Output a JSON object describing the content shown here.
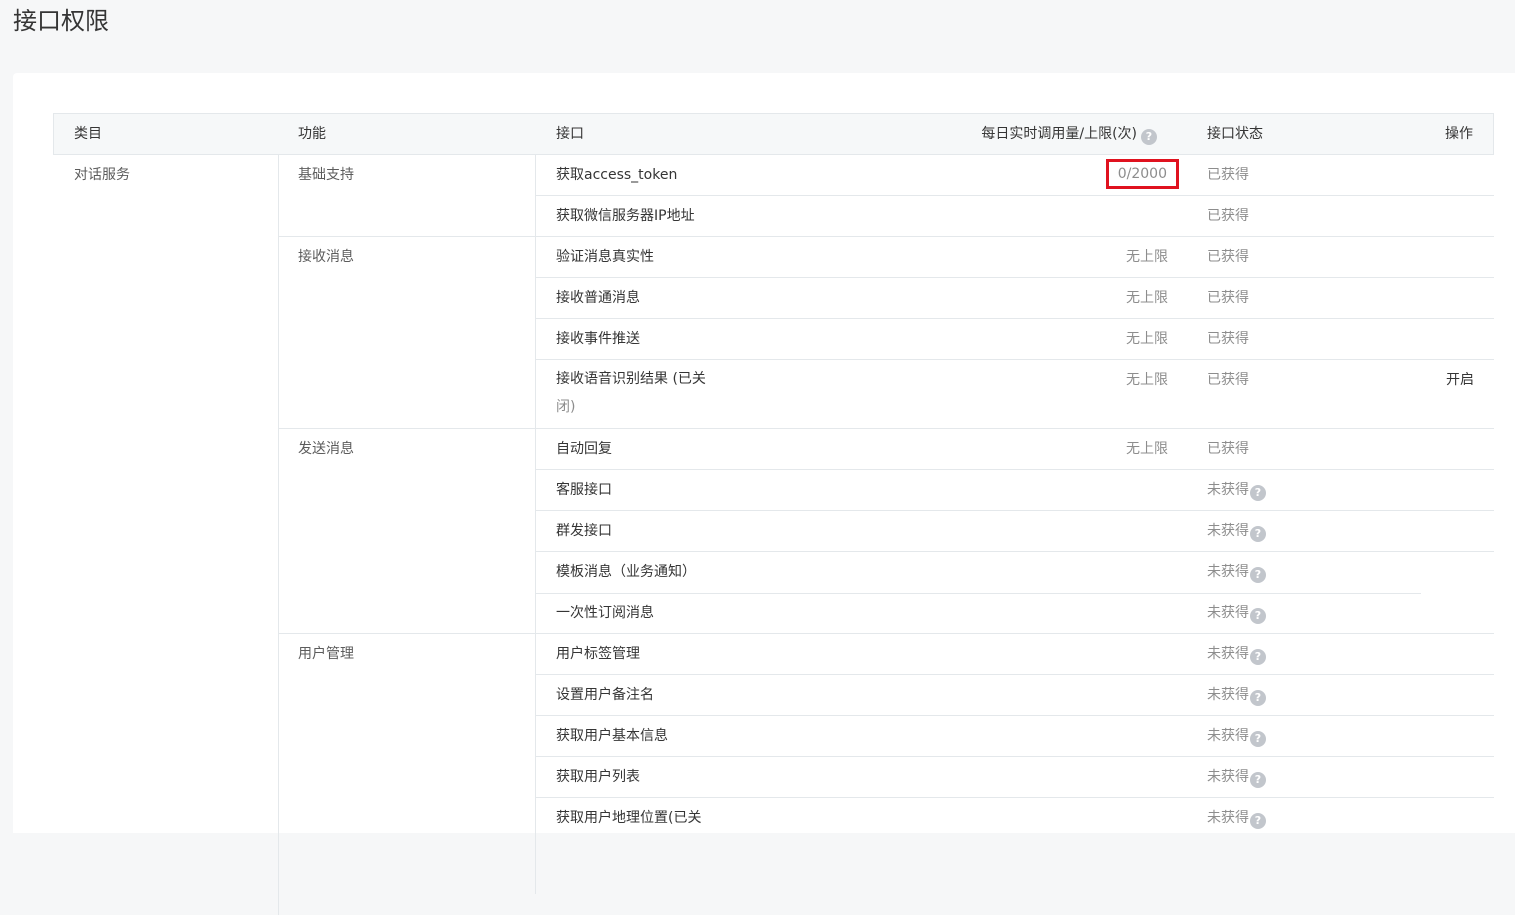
{
  "page": {
    "title": "接口权限"
  },
  "table": {
    "headers": {
      "category": "类目",
      "function": "功能",
      "api": "接口",
      "quota": "每日实时调用量/上限(次)",
      "status": "接口状态",
      "operation": "操作"
    },
    "category": "对话服务",
    "groups": [
      {
        "function": "基础支持"
      },
      {
        "function": "接收消息"
      },
      {
        "function": "发送消息"
      },
      {
        "function": "用户管理"
      }
    ],
    "rows": [
      {
        "api": "获取access_token",
        "quota": "0/2000",
        "status": "已获得"
      },
      {
        "api": "获取微信服务器IP地址",
        "quota": "",
        "status": "已获得"
      },
      {
        "api": "验证消息真实性",
        "quota": "无上限",
        "status": "已获得"
      },
      {
        "api": "接收普通消息",
        "quota": "无上限",
        "status": "已获得"
      },
      {
        "api": "接收事件推送",
        "quota": "无上限",
        "status": "已获得"
      },
      {
        "api": "接收语音识别结果 (已关",
        "api_line2": "闭)",
        "quota": "无上限",
        "status": "已获得",
        "operation": "开启"
      },
      {
        "api": "自动回复",
        "quota": "无上限",
        "status": "已获得"
      },
      {
        "api": "客服接口",
        "status": "未获得"
      },
      {
        "api": "群发接口",
        "status": "未获得"
      },
      {
        "api": "模板消息（业务通知）",
        "status": "未获得"
      },
      {
        "api": "一次性订阅消息",
        "status": "未获得"
      },
      {
        "api": "用户标签管理",
        "status": "未获得"
      },
      {
        "api": "设置用户备注名",
        "status": "未获得"
      },
      {
        "api": "获取用户基本信息",
        "status": "未获得"
      },
      {
        "api": "获取用户列表",
        "status": "未获得"
      },
      {
        "api": "获取用户地理位置(已关",
        "status": "未获得"
      }
    ],
    "help_icon": "question-circle-icon",
    "highlight_color": "#e0121f"
  }
}
